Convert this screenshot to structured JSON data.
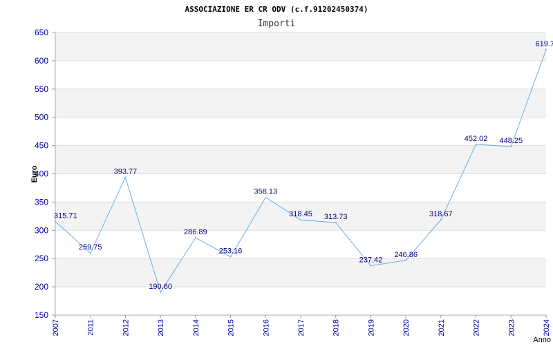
{
  "chart_data": {
    "type": "line",
    "title": "ASSOCIAZIONE ER CR ODV (c.f.91202450374)",
    "subtitle": "Importi",
    "xlabel": "Anno",
    "ylabel": "Euro",
    "ylim": [
      150,
      650
    ],
    "yticks": [
      150,
      200,
      250,
      300,
      350,
      400,
      450,
      500,
      550,
      600,
      650
    ],
    "grid": true,
    "legend": "none",
    "line_color": "#6aaee0",
    "categories": [
      "2007",
      "2011",
      "2012",
      "2013",
      "2014",
      "2015",
      "2016",
      "2017",
      "2018",
      "2019",
      "2020",
      "2021",
      "2022",
      "2023",
      "2024"
    ],
    "values": [
      315.71,
      259.75,
      393.77,
      190.6,
      286.89,
      253.16,
      358.13,
      318.45,
      313.73,
      237.42,
      246.86,
      318.67,
      452.02,
      448.25,
      619.7
    ],
    "value_labels": [
      "315.71",
      "259.75",
      "393.77",
      "190.60",
      "286.89",
      "253.16",
      "358.13",
      "318.45",
      "313.73",
      "237.42",
      "246.86",
      "318.67",
      "452.02",
      "448.25",
      "619.7"
    ]
  }
}
